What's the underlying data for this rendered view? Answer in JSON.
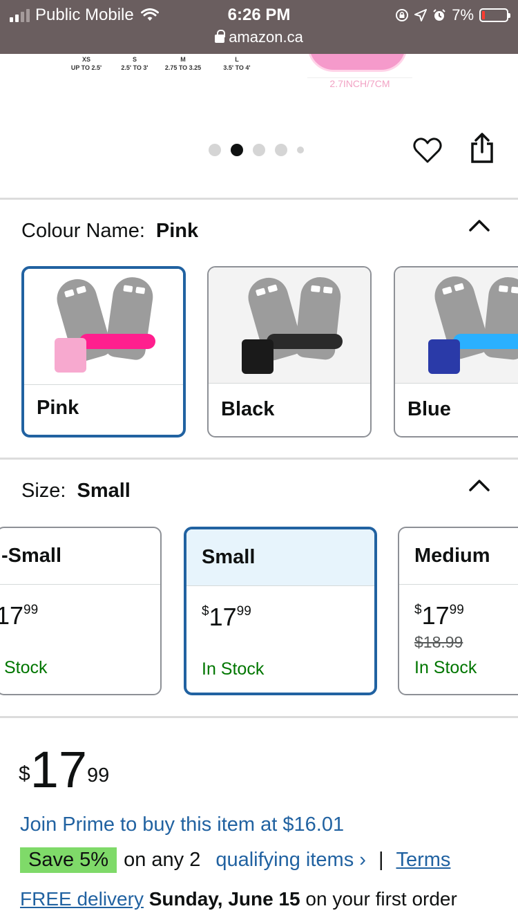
{
  "status_bar": {
    "carrier": "Public Mobile",
    "time": "6:26 PM",
    "url": "amazon.ca",
    "battery": "7%"
  },
  "size_chart": {
    "columns": [
      {
        "size": "XS",
        "range": "UP TO 2.5'"
      },
      {
        "size": "S",
        "range": "2.5' TO 3'"
      },
      {
        "size": "M",
        "range": "2.75 TO 3.25"
      },
      {
        "size": "L",
        "range": "3.5' TO 4'"
      }
    ],
    "dimension_label": "2.7INCH/7CM"
  },
  "carousel": {
    "dot_count": 5,
    "active_index": 1
  },
  "colour": {
    "title": "Colour Name:",
    "selected": "Pink",
    "options": [
      {
        "label": "Pink",
        "strap_color": "#ff1f8e",
        "wrist_color": "#f7a9cf"
      },
      {
        "label": "Black",
        "strap_color": "#2a2a2a",
        "wrist_color": "#1a1a1a"
      },
      {
        "label": "Blue",
        "strap_color": "#2ab0ff",
        "wrist_color": "#2a3aa8"
      }
    ]
  },
  "size": {
    "title": "Size:",
    "selected": "Small",
    "options": [
      {
        "name": "-Small",
        "price_symbol": "",
        "price_whole": "17",
        "price_cents": "99",
        "old_price": "",
        "stock": "Stock"
      },
      {
        "name": "Small",
        "price_symbol": "$",
        "price_whole": "17",
        "price_cents": "99",
        "old_price": "",
        "stock": "In Stock"
      },
      {
        "name": "Medium",
        "price_symbol": "$",
        "price_whole": "17",
        "price_cents": "99",
        "old_price": "$18.99",
        "stock": "In Stock"
      }
    ]
  },
  "price": {
    "symbol": "$",
    "whole": "17",
    "cents": "99"
  },
  "prime_offer": "Join Prime to buy this item at $16.01",
  "promo": {
    "badge": "Save 5%",
    "text": "on any 2",
    "link": "qualifying items ›",
    "separator": "|",
    "terms": "Terms"
  },
  "delivery": {
    "link": "FREE delivery",
    "date": "Sunday, June 15",
    "suffix": "on your first order"
  },
  "colors": {
    "link": "#2162a1",
    "in_stock": "#007600",
    "save_badge": "#7fda69",
    "selected_border": "#2162a1"
  }
}
